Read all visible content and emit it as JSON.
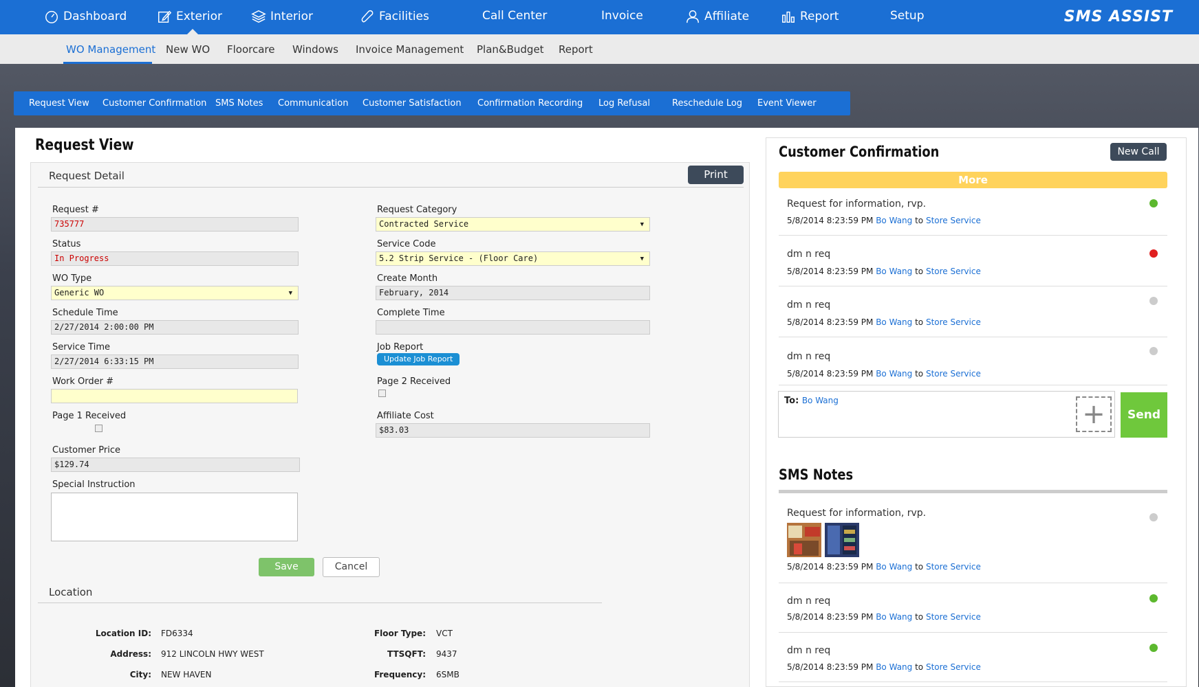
{
  "topnav": {
    "items": [
      {
        "label": "Dashboard",
        "icon": "dashboard-icon"
      },
      {
        "label": "Exterior",
        "icon": "edit-icon"
      },
      {
        "label": "Interior",
        "icon": "layers-icon"
      },
      {
        "label": "Facilities",
        "icon": "phone-icon"
      },
      {
        "label": "Call Center",
        "icon": ""
      },
      {
        "label": "Invoice",
        "icon": ""
      },
      {
        "label": "Affiliate",
        "icon": "user-icon"
      },
      {
        "label": "Report",
        "icon": "bar-chart-icon"
      },
      {
        "label": "Setup",
        "icon": ""
      }
    ],
    "logo": "SMS ASSIST"
  },
  "subnav": {
    "items": [
      "WO Management",
      "New WO",
      "Floorcare",
      "Windows",
      "Invoice Management",
      "Plan&Budget",
      "Report"
    ]
  },
  "tabbar": {
    "items": [
      "Request View",
      "Customer Confirmation",
      "SMS Notes",
      "Communication",
      "Customer Satisfaction",
      "Confirmation Recording",
      "Log Refusal",
      "Reschedule Log",
      "Event Viewer"
    ]
  },
  "request": {
    "title": "Request View",
    "detail_head": "Request Detail",
    "print": "Print",
    "request_no_label": "Request #",
    "request_no": "735777",
    "status_label": "Status",
    "status": "In Progress",
    "wo_type_label": "WO Type",
    "wo_type": "Generic WO",
    "schedule_label": "Schedule Time",
    "schedule": "2/27/2014 2:00:00 PM",
    "service_time_label": "Service Time",
    "service_time": "2/27/2014 6:33:15 PM",
    "work_order_label": "Work Order #",
    "work_order": "",
    "page1_label": "Page 1 Received",
    "customer_price_label": "Customer Price",
    "customer_price": "$129.74",
    "special_label": "Special Instruction",
    "category_label": "Request Category",
    "category": "Contracted Service",
    "service_code_label": "Service Code",
    "service_code": "5.2 Strip Service - (Floor Care)",
    "create_month_label": "Create Month",
    "create_month": "February, 2014",
    "complete_label": "Complete Time",
    "complete": "",
    "job_report_label": "Job Report",
    "job_report_btn": "Update Job Report",
    "page2_label": "Page 2 Received",
    "affiliate_cost_label": "Affiliate Cost",
    "affiliate_cost": "$83.03",
    "save": "Save",
    "cancel": "Cancel"
  },
  "location": {
    "head": "Location",
    "location_id_label": "Location ID:",
    "location_id": "FD6334",
    "address_label": "Address:",
    "address": "912 LINCOLN HWY WEST",
    "city_label": "City:",
    "city": "NEW HAVEN",
    "floor_type_label": "Floor Type:",
    "floor_type": "VCT",
    "ttsqft_label": "TTSQFT:",
    "ttsqft": "9437",
    "frequency_label": "Frequency:",
    "frequency": "6SMB"
  },
  "confirmation": {
    "title": "Customer Confirmation",
    "new_call": "New Call",
    "more": "More",
    "messages": [
      {
        "text": "Request for information, rvp.",
        "time": "5/8/2014 8:23:59 PM",
        "from": "Bo Wang",
        "to_word": "to",
        "to": "Store Service",
        "status_color": "#5cb82e"
      },
      {
        "text": "dm n req",
        "time": "5/8/2014 8:23:59 PM",
        "from": "Bo Wang",
        "to_word": "to",
        "to": "Store Service",
        "status_color": "#e02020"
      },
      {
        "text": "dm n req",
        "time": "5/8/2014 8:23:59 PM",
        "from": "Bo Wang",
        "to_word": "to",
        "to": "Store Service",
        "status_color": "#cccccc"
      },
      {
        "text": "dm n req",
        "time": "5/8/2014 8:23:59 PM",
        "from": "Bo Wang",
        "to_word": "to",
        "to": "Store Service",
        "status_color": "#cccccc"
      }
    ],
    "to_label": "To:",
    "to_name": "Bo Wang",
    "send": "Send"
  },
  "sms_notes": {
    "title": "SMS Notes",
    "messages": [
      {
        "text": "Request for information, rvp.",
        "time": "5/8/2014 8:23:59 PM",
        "from": "Bo Wang",
        "to_word": "to",
        "to": "Store Service",
        "status_color": "#cccccc"
      },
      {
        "text": "dm n req",
        "time": "5/8/2014 8:23:59 PM",
        "from": "Bo Wang",
        "to_word": "to",
        "to": "Store Service",
        "status_color": "#5cb82e"
      },
      {
        "text": "dm n req",
        "time": "5/8/2014 8:23:59 PM",
        "from": "Bo Wang",
        "to_word": "to",
        "to": "Store Service",
        "status_color": "#5cb82e"
      }
    ]
  }
}
